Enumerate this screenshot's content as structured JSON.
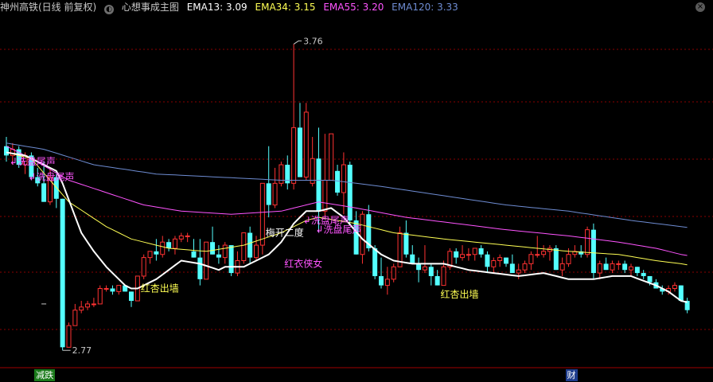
{
  "header": {
    "stock": "神州高铁(日线 前复权)",
    "indicator": "心想事成主图",
    "ema13": "EMA13: 3.09",
    "ema34": "EMA34: 3.15",
    "ema55": "EMA55: 3.20",
    "ema120": "EMA120: 3.33"
  },
  "colors": {
    "up": "#ff3232",
    "down": "#54ffff",
    "ema13": "#ffffff",
    "ema34": "#ffff54",
    "ema55": "#ff54ff",
    "ema120": "#6e8cd2",
    "grid": "#8a0000",
    "signal_magenta": "#ff54ff",
    "signal_yellow": "#ffff54",
    "tag_green": "#1a7a1a",
    "tag_blue": "#1e3c8c"
  },
  "chart_data": {
    "type": "candlestick",
    "ylim": [
      2.74,
      3.8
    ],
    "max_label": "3.76",
    "min_label": "2.77",
    "candles": [
      [
        3.42,
        3.45,
        3.37,
        3.39
      ],
      [
        3.39,
        3.43,
        3.36,
        3.41
      ],
      [
        3.41,
        3.42,
        3.35,
        3.36
      ],
      [
        3.36,
        3.4,
        3.33,
        3.39
      ],
      [
        3.39,
        3.4,
        3.31,
        3.32
      ],
      [
        3.32,
        3.35,
        3.29,
        3.3
      ],
      [
        3.3,
        3.37,
        3.24,
        3.24
      ],
      [
        3.24,
        3.35,
        3.23,
        3.32
      ],
      [
        3.32,
        3.33,
        3.22,
        3.25
      ],
      [
        3.25,
        3.25,
        2.76,
        2.77
      ],
      [
        2.77,
        2.85,
        2.77,
        2.84
      ],
      [
        2.84,
        2.91,
        2.84,
        2.89
      ],
      [
        2.89,
        2.92,
        2.88,
        2.9
      ],
      [
        2.9,
        2.92,
        2.89,
        2.91
      ],
      [
        2.91,
        2.93,
        2.9,
        2.91
      ],
      [
        2.91,
        2.97,
        2.91,
        2.96
      ],
      [
        2.96,
        2.97,
        2.95,
        2.96
      ],
      [
        2.96,
        2.97,
        2.94,
        2.95
      ],
      [
        2.95,
        2.97,
        2.94,
        2.97
      ],
      [
        2.97,
        2.97,
        2.95,
        2.95
      ],
      [
        2.95,
        2.95,
        2.9,
        2.92
      ],
      [
        2.92,
        3.0,
        2.92,
        3.0
      ],
      [
        3.0,
        3.07,
        2.99,
        3.06
      ],
      [
        3.06,
        3.08,
        3.04,
        3.08
      ],
      [
        3.08,
        3.12,
        3.05,
        3.07
      ],
      [
        3.07,
        3.13,
        3.06,
        3.11
      ],
      [
        3.11,
        3.12,
        3.08,
        3.09
      ],
      [
        3.09,
        3.13,
        3.07,
        3.12
      ],
      [
        3.12,
        3.14,
        3.11,
        3.13
      ],
      [
        3.13,
        3.14,
        3.11,
        3.13
      ],
      [
        3.08,
        3.12,
        3.06,
        3.06
      ],
      [
        3.06,
        3.12,
        2.97,
        2.99
      ],
      [
        2.99,
        3.11,
        2.99,
        3.11
      ],
      [
        3.11,
        3.16,
        3.07,
        3.07
      ],
      [
        3.07,
        3.1,
        3.04,
        3.06
      ],
      [
        3.06,
        3.11,
        3.04,
        3.1
      ],
      [
        3.1,
        3.1,
        3.0,
        3.01
      ],
      [
        3.01,
        3.08,
        3.0,
        3.05
      ],
      [
        3.05,
        3.14,
        3.04,
        3.14
      ],
      [
        3.14,
        3.16,
        3.04,
        3.06
      ],
      [
        3.06,
        3.13,
        3.05,
        3.1
      ],
      [
        3.1,
        3.3,
        3.07,
        3.3
      ],
      [
        3.3,
        3.42,
        3.19,
        3.23
      ],
      [
        3.23,
        3.35,
        3.22,
        3.3
      ],
      [
        3.3,
        3.37,
        3.29,
        3.36
      ],
      [
        3.36,
        3.39,
        3.28,
        3.3
      ],
      [
        3.3,
        3.75,
        3.28,
        3.48
      ],
      [
        3.48,
        3.56,
        3.32,
        3.32
      ],
      [
        3.32,
        3.56,
        3.31,
        3.53
      ],
      [
        3.3,
        3.45,
        3.29,
        3.38
      ],
      [
        3.38,
        3.48,
        3.14,
        3.21
      ],
      [
        3.21,
        3.46,
        3.19,
        3.31
      ],
      [
        3.31,
        3.46,
        3.31,
        3.46
      ],
      [
        3.34,
        3.36,
        3.26,
        3.27
      ],
      [
        3.27,
        3.4,
        3.2,
        3.36
      ],
      [
        3.36,
        3.37,
        3.17,
        3.18
      ],
      [
        3.18,
        3.21,
        3.07,
        3.07
      ],
      [
        3.07,
        3.21,
        3.04,
        3.2
      ],
      [
        3.2,
        3.23,
        3.08,
        3.09
      ],
      [
        3.09,
        3.1,
        2.99,
        3.0
      ],
      [
        3.0,
        3.06,
        2.96,
        2.97
      ],
      [
        2.97,
        3.03,
        2.94,
        2.99
      ],
      [
        2.99,
        3.04,
        2.98,
        3.03
      ],
      [
        3.03,
        3.16,
        3.03,
        3.14
      ],
      [
        3.14,
        3.18,
        3.06,
        3.07
      ],
      [
        3.07,
        3.1,
        3.04,
        3.04
      ],
      [
        3.04,
        3.06,
        2.98,
        3.02
      ],
      [
        3.02,
        3.1,
        3.01,
        3.03
      ],
      [
        3.03,
        3.04,
        2.97,
        3.0
      ],
      [
        3.0,
        3.02,
        2.97,
        2.97
      ],
      [
        2.97,
        3.05,
        2.97,
        3.03
      ],
      [
        3.03,
        3.09,
        3.02,
        3.08
      ],
      [
        3.08,
        3.09,
        3.04,
        3.06
      ],
      [
        3.06,
        3.1,
        3.05,
        3.07
      ],
      [
        3.07,
        3.09,
        3.05,
        3.07
      ],
      [
        3.07,
        3.09,
        3.05,
        3.09
      ],
      [
        3.09,
        3.1,
        3.06,
        3.07
      ],
      [
        3.07,
        3.08,
        3.01,
        3.03
      ],
      [
        3.03,
        3.06,
        3.01,
        3.05
      ],
      [
        3.05,
        3.07,
        3.03,
        3.06
      ],
      [
        3.06,
        3.06,
        3.03,
        3.04
      ],
      [
        3.04,
        3.07,
        3.01,
        3.01
      ],
      [
        3.01,
        3.04,
        2.99,
        3.02
      ],
      [
        3.02,
        3.05,
        3.01,
        3.04
      ],
      [
        3.04,
        3.08,
        3.02,
        3.07
      ],
      [
        3.07,
        3.13,
        3.06,
        3.07
      ],
      [
        3.07,
        3.1,
        3.06,
        3.08
      ],
      [
        3.08,
        3.1,
        3.05,
        3.09
      ],
      [
        3.09,
        3.1,
        3.02,
        3.02
      ],
      [
        3.02,
        3.06,
        3.0,
        3.04
      ],
      [
        3.04,
        3.09,
        3.03,
        3.07
      ],
      [
        3.07,
        3.1,
        3.06,
        3.08
      ],
      [
        3.08,
        3.1,
        3.06,
        3.07
      ],
      [
        3.07,
        3.16,
        3.06,
        3.15
      ],
      [
        3.15,
        3.17,
        2.99,
        3.01
      ],
      [
        3.01,
        3.05,
        2.99,
        3.04
      ],
      [
        3.04,
        3.06,
        3.02,
        3.02
      ],
      [
        3.02,
        3.05,
        3.01,
        3.04
      ],
      [
        3.04,
        3.05,
        3.02,
        3.04
      ],
      [
        3.04,
        3.05,
        3.01,
        3.02
      ],
      [
        3.02,
        3.04,
        3.0,
        3.03
      ],
      [
        3.03,
        3.03,
        3.0,
        3.01
      ],
      [
        3.01,
        3.02,
        2.99,
        3.0
      ],
      [
        3.0,
        3.0,
        2.97,
        2.98
      ],
      [
        2.98,
        2.99,
        2.96,
        2.96
      ],
      [
        2.96,
        2.97,
        2.94,
        2.95
      ],
      [
        2.95,
        2.97,
        2.94,
        2.96
      ],
      [
        2.96,
        2.98,
        2.95,
        2.97
      ],
      [
        2.97,
        2.97,
        2.92,
        2.92
      ],
      [
        2.92,
        2.93,
        2.88,
        2.89
      ]
    ],
    "ema13_anchors": [
      [
        0,
        3.4
      ],
      [
        3,
        3.39
      ],
      [
        8,
        3.34
      ],
      [
        9,
        3.3
      ],
      [
        12,
        3.14
      ],
      [
        14,
        3.08
      ],
      [
        16,
        3.03
      ],
      [
        18,
        2.99
      ],
      [
        19,
        2.97
      ],
      [
        20,
        2.96
      ],
      [
        21,
        2.96
      ],
      [
        24,
        2.99
      ],
      [
        28,
        3.05
      ],
      [
        31,
        3.04
      ],
      [
        34,
        3.02
      ],
      [
        35,
        3.03
      ],
      [
        38,
        3.03
      ],
      [
        42,
        3.07
      ],
      [
        44,
        3.11
      ],
      [
        46,
        3.17
      ],
      [
        48,
        3.21
      ],
      [
        50,
        3.21
      ],
      [
        52,
        3.22
      ],
      [
        54,
        3.19
      ],
      [
        57,
        3.12
      ],
      [
        60,
        3.07
      ],
      [
        62,
        3.05
      ],
      [
        65,
        3.04
      ],
      [
        70,
        3.04
      ],
      [
        74,
        3.02
      ],
      [
        78,
        3.01
      ],
      [
        82,
        3.0
      ],
      [
        86,
        3.01
      ],
      [
        88,
        3.0
      ],
      [
        90,
        2.99
      ],
      [
        94,
        2.99
      ],
      [
        97,
        3.0
      ],
      [
        100,
        3.0
      ],
      [
        104,
        2.97
      ],
      [
        106,
        2.95
      ],
      [
        108,
        2.92
      ]
    ],
    "ema34_anchors": [
      [
        0,
        3.4
      ],
      [
        4,
        3.38
      ],
      [
        10,
        3.24
      ],
      [
        16,
        3.16
      ],
      [
        20,
        3.12
      ],
      [
        26,
        3.09
      ],
      [
        32,
        3.08
      ],
      [
        38,
        3.1
      ],
      [
        44,
        3.14
      ],
      [
        48,
        3.18
      ],
      [
        50,
        3.19
      ],
      [
        56,
        3.17
      ],
      [
        62,
        3.14
      ],
      [
        70,
        3.12
      ],
      [
        80,
        3.1
      ],
      [
        90,
        3.08
      ],
      [
        98,
        3.07
      ],
      [
        104,
        3.05
      ],
      [
        108,
        3.04
      ]
    ],
    "ema55_anchors": [
      [
        0,
        3.42
      ],
      [
        4,
        3.38
      ],
      [
        10,
        3.31
      ],
      [
        16,
        3.27
      ],
      [
        22,
        3.23
      ],
      [
        28,
        3.21
      ],
      [
        36,
        3.2
      ],
      [
        44,
        3.21
      ],
      [
        50,
        3.24
      ],
      [
        56,
        3.22
      ],
      [
        64,
        3.19
      ],
      [
        72,
        3.17
      ],
      [
        80,
        3.15
      ],
      [
        90,
        3.13
      ],
      [
        98,
        3.11
      ],
      [
        104,
        3.09
      ],
      [
        108,
        3.07
      ]
    ],
    "ema120_anchors": [
      [
        0,
        3.43
      ],
      [
        6,
        3.41
      ],
      [
        14,
        3.36
      ],
      [
        24,
        3.33
      ],
      [
        34,
        3.32
      ],
      [
        44,
        3.31
      ],
      [
        52,
        3.31
      ],
      [
        60,
        3.29
      ],
      [
        70,
        3.26
      ],
      [
        80,
        3.23
      ],
      [
        90,
        3.21
      ],
      [
        100,
        3.18
      ],
      [
        108,
        3.16
      ]
    ],
    "annotations": [
      {
        "idx": 1,
        "price": 3.36,
        "text": "↲洗盘尾声",
        "color": "magenta",
        "align": "left"
      },
      {
        "idx": 4,
        "price": 3.31,
        "text": "↲洗盘尾声",
        "color": "magenta",
        "align": "left"
      },
      {
        "idx": 22,
        "price": 2.95,
        "text": "红杏出墙",
        "color": "yellow",
        "align": "left"
      },
      {
        "idx": 42,
        "price": 3.13,
        "text": "梅开二度",
        "color": "white",
        "align": "left"
      },
      {
        "idx": 45,
        "price": 3.03,
        "text": "红衣侠女",
        "color": "magenta",
        "align": "left"
      },
      {
        "idx": 48,
        "price": 3.17,
        "text": "↲洗盘尾声",
        "color": "magenta",
        "align": "left"
      },
      {
        "idx": 50,
        "price": 3.14,
        "text": "↲洗盘尾声",
        "color": "magenta",
        "align": "left"
      },
      {
        "idx": 70,
        "price": 2.93,
        "text": "红杏出墙",
        "color": "yellow",
        "align": "left"
      }
    ],
    "dash_marker": {
      "idx": 6,
      "price": 2.91
    },
    "bottom_tags": [
      {
        "idx": 5,
        "text": "减跌",
        "color": "green"
      },
      {
        "idx": 90,
        "text": "财",
        "color": "blue"
      }
    ]
  }
}
